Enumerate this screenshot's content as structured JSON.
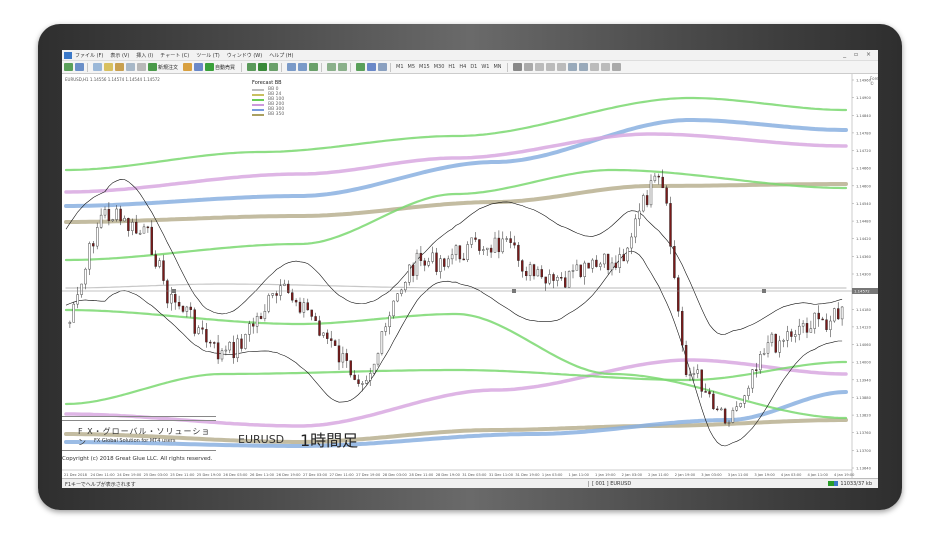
{
  "menu": {
    "items": [
      "ファイル (F)",
      "表示 (V)",
      "挿入 (I)",
      "チャート (C)",
      "ツール (T)",
      "ウィンドウ (W)",
      "ヘルプ (H)"
    ],
    "window_controls": "_ ▫ ×"
  },
  "toolbar": {
    "new_order": "新規注文",
    "auto_trade": "自動売買",
    "timeframes": [
      "M1",
      "M5",
      "M15",
      "M30",
      "H1",
      "H4",
      "D1",
      "W1",
      "MN"
    ]
  },
  "chart": {
    "info": "EURUSD,H1  1.14556 1.14574 1.14544 1.14572",
    "corner_label": "Forex#77 ©",
    "legend_title": "Forecast BB",
    "legend": [
      {
        "name": "BB 0",
        "color": "#bdbdbd"
      },
      {
        "name": "BB 24",
        "color": "#c8c060"
      },
      {
        "name": "BB 100",
        "color": "#66cc55"
      },
      {
        "name": "BB 200",
        "color": "#cc99dd"
      },
      {
        "name": "BB 300",
        "color": "#7799dd"
      },
      {
        "name": "BB 350",
        "color": "#aaa060"
      }
    ],
    "price_axis": [
      "1.14960",
      "1.14900",
      "1.14840",
      "1.14780",
      "1.14720",
      "1.14660",
      "1.14600",
      "1.14540",
      "1.14480",
      "1.14420",
      "1.14360",
      "1.14300",
      "1.14240",
      "1.14180",
      "1.14120",
      "1.14060",
      "1.14000",
      "1.13940",
      "1.13880",
      "1.13820",
      "1.13760",
      "1.13700",
      "1.13640"
    ],
    "current_price": "1.14572",
    "time_axis": [
      "21 Dec 2018",
      "24 Dec 11:00",
      "24 Dec 19:00",
      "25 Dec 03:00",
      "25 Dec 11:00",
      "25 Dec 19:00",
      "26 Dec 03:00",
      "26 Dec 11:00",
      "26 Dec 19:00",
      "27 Dec 03:00",
      "27 Dec 11:00",
      "27 Dec 19:00",
      "28 Dec 03:00",
      "28 Dec 11:00",
      "28 Dec 19:00",
      "31 Dec 03:00",
      "31 Dec 11:00",
      "31 Dec 19:00",
      "1 Jan 03:00",
      "1 Jan 11:00",
      "1 Jan 19:00",
      "2 Jan 03:00",
      "2 Jan 11:00",
      "2 Jan 19:00",
      "3 Jan 03:00",
      "3 Jan 11:00",
      "3 Jan 19:00",
      "4 Jan 03:00",
      "4 Jan 11:00",
      "4 Jan 19:00"
    ]
  },
  "branding": {
    "title_ja": "F X・グローバル・ソリューション",
    "title_en": "FX Global Solution for MT4 users",
    "copyright": "Copyright (c) 2018  Great Glue LLC.  All rights reserved.",
    "symbol": "EURUSD",
    "timeframe_label": "1時間足"
  },
  "status": {
    "help": "F1キーでヘルプが表示されます",
    "profile": "[ 001 ]  EURUSD",
    "traffic": "11033/37 kb"
  }
}
